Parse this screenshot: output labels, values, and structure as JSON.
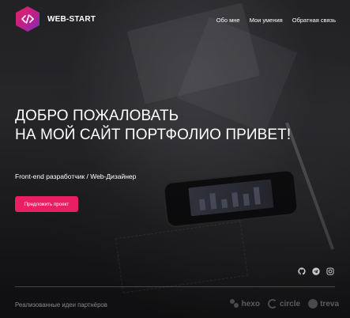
{
  "brand": {
    "name": "WEB-START",
    "accent": "#e91e63",
    "logo_gradient": [
      "#e0245e",
      "#7a2fc0"
    ]
  },
  "nav": {
    "items": [
      {
        "label": "Обо мне"
      },
      {
        "label": "Мои умения"
      },
      {
        "label": "Обратная связь"
      }
    ]
  },
  "hero": {
    "title_line1": "ДОБРО ПОЖАЛОВАТЬ",
    "title_line2": "НА МОЙ САЙТ ПОРТФОЛИО ПРИВЕТ!",
    "subtitle": "Front-end разработчик / Web-Дизайнер",
    "cta_label": "Предложить проект"
  },
  "socials": {
    "icons": [
      "github-icon",
      "telegram-icon",
      "instagram-icon"
    ]
  },
  "footer": {
    "partners_label": "Реализованные идеи партнёров",
    "partners": [
      {
        "name": "hexo",
        "icon": "hexo-logo-icon"
      },
      {
        "name": "circle",
        "icon": "circle-logo-icon"
      },
      {
        "name": "treva",
        "icon": "treva-logo-icon"
      }
    ]
  }
}
